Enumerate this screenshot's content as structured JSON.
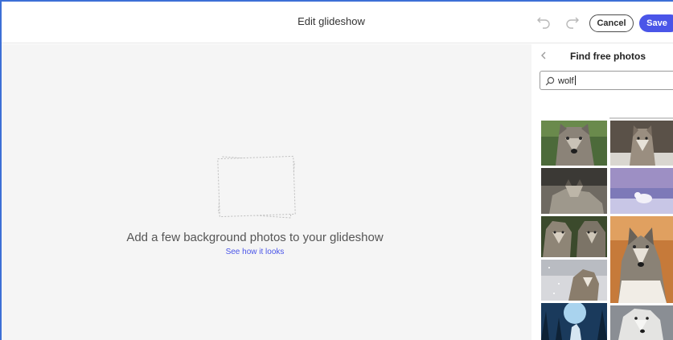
{
  "header": {
    "title": "Edit glideshow",
    "cancel_label": "Cancel",
    "save_label": "Save"
  },
  "canvas": {
    "hint": "Add a few background photos to your glideshow",
    "link": "See how it looks"
  },
  "panel": {
    "title": "Find free photos",
    "search_value": "wolf",
    "results": [
      {
        "name": "wolf-closeup-forest"
      },
      {
        "name": "wolf-standing-snow"
      },
      {
        "name": "wolf-lying-rocks"
      },
      {
        "name": "arctic-fox-snow-sunset"
      },
      {
        "name": "two-wolves-portrait"
      },
      {
        "name": "grey-wolf-winter"
      },
      {
        "name": "wolf-snowfall"
      },
      {
        "name": "wolf-blue-forest"
      },
      {
        "name": "white-wolf-closeup"
      }
    ]
  },
  "colors": {
    "accent": "#4a55e8",
    "canvas_bg": "#f5f5f5",
    "frame": "#3c6fd6"
  }
}
